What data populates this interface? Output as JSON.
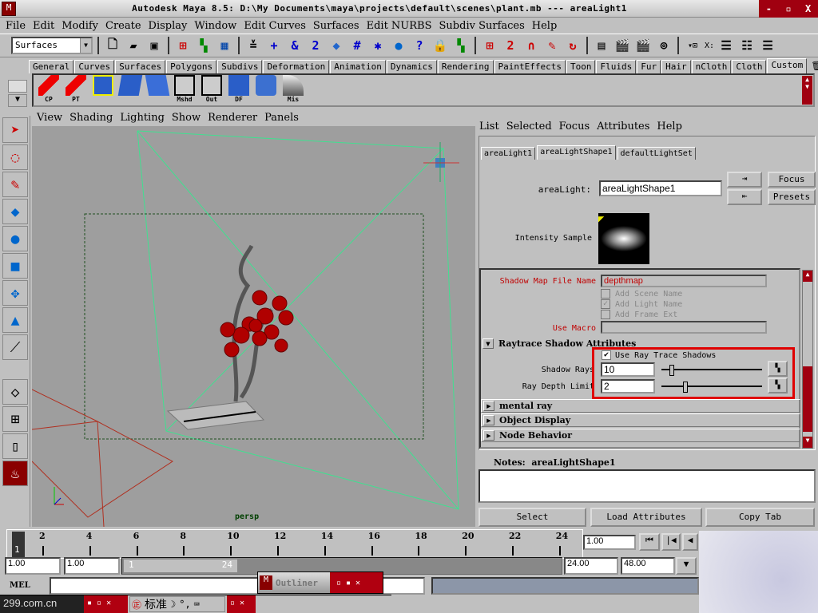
{
  "window": {
    "title": "Autodesk Maya 8.5: D:\\My Documents\\maya\\projects\\default\\scenes\\plant.mb   ---   areaLight1",
    "controls": [
      "-",
      "▫",
      "X"
    ]
  },
  "menu": [
    "File",
    "Edit",
    "Modify",
    "Create",
    "Display",
    "Window",
    "Edit Curves",
    "Surfaces",
    "Edit NURBS",
    "Subdiv Surfaces",
    "Help"
  ],
  "toolbar": {
    "menu_set": "Surfaces",
    "xlabel": "X:"
  },
  "shelf_tabs": [
    "General",
    "Curves",
    "Surfaces",
    "Polygons",
    "Subdivs",
    "Deformation",
    "Animation",
    "Dynamics",
    "Rendering",
    "PaintEffects",
    "Toon",
    "Fluids",
    "Fur",
    "Hair",
    "nCloth",
    "Cloth",
    "Custom"
  ],
  "shelf_active": "Custom",
  "shelf_items": [
    "CP",
    "PT",
    "",
    "",
    "",
    "Mshd",
    "Out",
    "DF",
    "",
    "Mis"
  ],
  "viewport": {
    "menu": [
      "View",
      "Shading",
      "Lighting",
      "Show",
      "Renderer",
      "Panels"
    ],
    "camera_label": "persp"
  },
  "attribute_editor": {
    "menu": [
      "List",
      "Selected",
      "Focus",
      "Attributes",
      "Help"
    ],
    "tabs": [
      "areaLight1",
      "areaLightShape1",
      "defaultLightSet"
    ],
    "active_tab": "areaLightShape1",
    "node_label": "areaLight:",
    "node_value": "areaLightShape1",
    "focus": "Focus",
    "presets": "Presets",
    "intensity_sample": "Intensity Sample",
    "shadow_map_file_name_label": "Shadow Map File Name",
    "shadow_map_file_name": "depthmap",
    "add_scene_name": "Add Scene Name",
    "add_light_name": "Add Light Name",
    "add_frame_ext": "Add Frame Ext",
    "use_macro": "Use Macro",
    "raytrace_section": "Raytrace Shadow Attributes",
    "use_ray_trace_shadows": "Use Ray Trace Shadows",
    "use_ray_trace_shadows_checked": true,
    "shadow_rays_label": "Shadow Rays",
    "shadow_rays": "10",
    "ray_depth_limit_label": "Ray Depth Limit",
    "ray_depth_limit": "2",
    "sections": [
      "mental ray",
      "Object Display",
      "Node Behavior"
    ],
    "notes_label": "Notes:",
    "notes_node": "areaLightShape1",
    "buttons": [
      "Select",
      "Load Attributes",
      "Copy Tab"
    ],
    "highlight_color": "#e00000"
  },
  "timeline": {
    "ticks": [
      "2",
      "4",
      "6",
      "8",
      "10",
      "12",
      "14",
      "16",
      "18",
      "20",
      "22",
      "24"
    ],
    "current": "1",
    "current_time": "1.00"
  },
  "range": {
    "start": "1.00",
    "playback_start": "1.00",
    "slider_start": "1",
    "slider_end": "24",
    "playback_end": "24.00",
    "end": "48.00"
  },
  "command_line": {
    "label": "MEL"
  },
  "taskbar": {
    "outliner": "Outliner",
    "watermark": "299.com.cn",
    "ime": "标准"
  }
}
